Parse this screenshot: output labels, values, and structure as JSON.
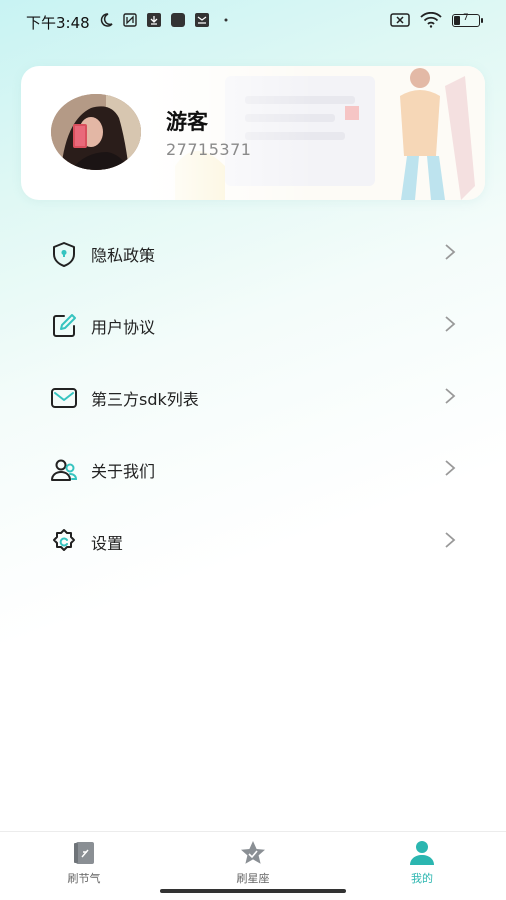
{
  "status_bar": {
    "time": "下午3:48",
    "left_icons": [
      "moon-icon",
      "nfc-icon",
      "download-icon",
      "app-icon",
      "mail-icon",
      "dot-icon"
    ],
    "right_icons": [
      "sim-off-icon",
      "wifi-icon",
      "battery-icon"
    ],
    "battery_level": "7"
  },
  "profile": {
    "name": "游客",
    "id": "27715371"
  },
  "menu": {
    "items": [
      {
        "label": "隐私政策",
        "icon": "shield-icon"
      },
      {
        "label": "用户协议",
        "icon": "edit-icon"
      },
      {
        "label": "第三方sdk列表",
        "icon": "envelope-icon"
      },
      {
        "label": "关于我们",
        "icon": "users-icon"
      },
      {
        "label": "设置",
        "icon": "settings-icon"
      }
    ]
  },
  "tabs": [
    {
      "label": "刷节气",
      "icon": "book-icon",
      "active": false
    },
    {
      "label": "刷星座",
      "icon": "star-icon",
      "active": false
    },
    {
      "label": "我的",
      "icon": "person-icon",
      "active": true
    }
  ],
  "colors": {
    "accent": "#2bb6b0",
    "icon_teal": "#36c4c0",
    "text": "#222222",
    "muted": "#8a8a8a"
  }
}
